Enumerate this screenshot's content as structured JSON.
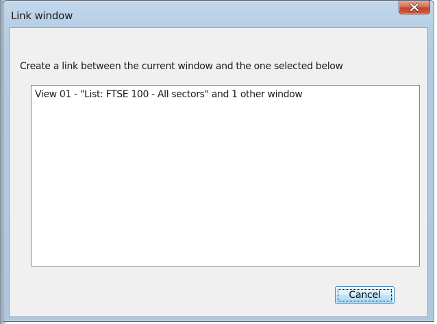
{
  "window": {
    "title": "Link window",
    "close_glyph": "X",
    "close_icon": "close-icon"
  },
  "dialog": {
    "prompt": "Create a link between the current window and the one selected below",
    "list_items": [
      "View 01 - \"List: FTSE 100 - All sectors\" and 1 other window"
    ],
    "cancel_label": "Cancel"
  },
  "colors": {
    "title_bar": "#b9d0e7",
    "close_button": "#c7452a",
    "client_bg": "#f0f0f0",
    "button_border": "#3c7fb1"
  }
}
